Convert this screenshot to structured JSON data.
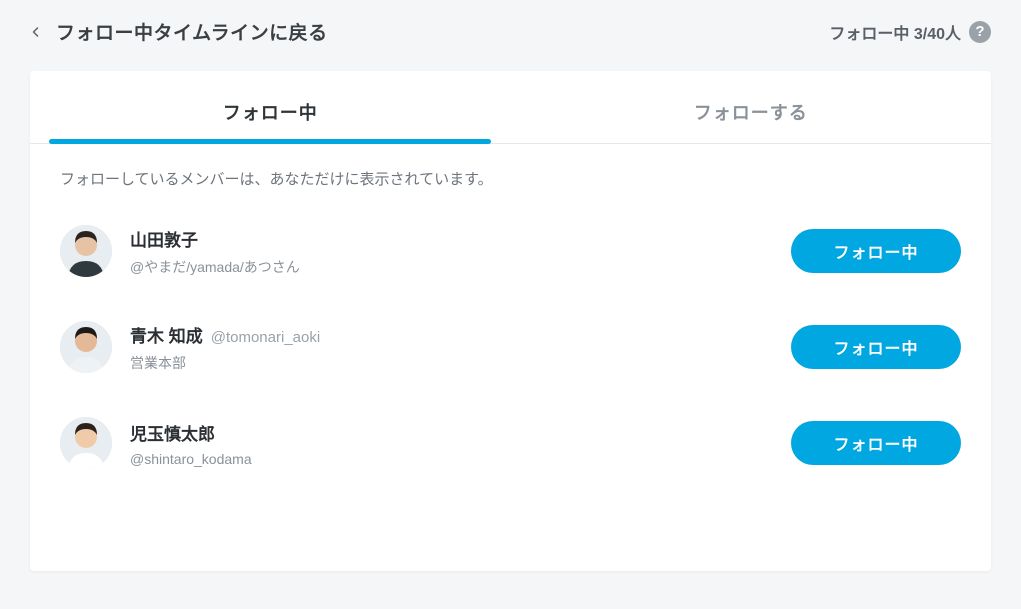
{
  "header": {
    "back_label": "フォロー中タイムラインに戻る",
    "count_label": "フォロー中 3/40人"
  },
  "tabs": [
    {
      "label": "フォロー中",
      "active": true
    },
    {
      "label": "フォローする",
      "active": false
    }
  ],
  "notice": "フォローしているメンバーは、あなただけに表示されています。",
  "button_label": "フォロー中",
  "members": [
    {
      "name": "山田敦子",
      "handle_inline": "",
      "sub": "@やまだ/yamada/あつさん",
      "avatar": {
        "skin": "#e7c3a6",
        "hair": "#2a2320",
        "shirt": "#2f3a3f"
      }
    },
    {
      "name": "青木 知成",
      "handle_inline": "@tomonari_aoki",
      "sub": "営業本部",
      "avatar": {
        "skin": "#e3b998",
        "hair": "#1f1a18",
        "shirt": "#eef2f5"
      }
    },
    {
      "name": "児玉慎太郎",
      "handle_inline": "",
      "sub": "@shintaro_kodama",
      "avatar": {
        "skin": "#f0cba9",
        "hair": "#2b221c",
        "shirt": "#ffffff"
      }
    }
  ]
}
